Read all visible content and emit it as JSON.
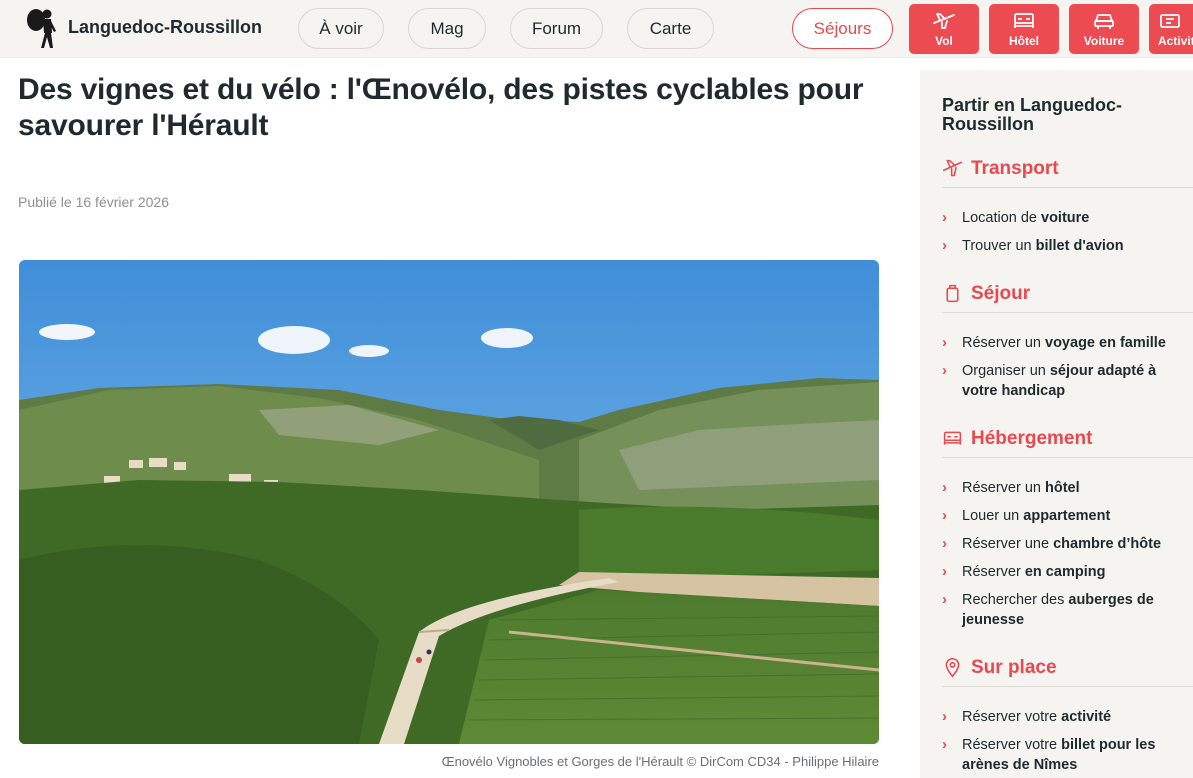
{
  "header": {
    "site_name": "Languedoc-Roussillon",
    "nav": [
      "À voir",
      "Mag",
      "Forum",
      "Carte"
    ],
    "sejours": "Séjours",
    "tiles": [
      {
        "label": "Vol",
        "icon": "plane-icon"
      },
      {
        "label": "Hôtel",
        "icon": "bed-icon"
      },
      {
        "label": "Voiture",
        "icon": "car-icon"
      },
      {
        "label": "Activit",
        "icon": "ticket-icon"
      }
    ]
  },
  "article": {
    "title": "Des vignes et du vélo : l'Œnovélo, des pistes cyclables pour savourer l'Hérault",
    "published": "Publié le 16 février 2026",
    "caption": "Œnovélo Vignobles et Gorges de l'Hérault © DirCom CD34 - Philippe Hilaire"
  },
  "sidebar": {
    "title": "Partir en Languedoc-Roussillon",
    "sections": [
      {
        "title": "Transport",
        "icon": "plane-icon",
        "links": [
          {
            "pre": "Location de ",
            "bold": "voiture",
            "post": ""
          },
          {
            "pre": "Trouver un ",
            "bold": "billet d'avion",
            "post": ""
          }
        ]
      },
      {
        "title": "Séjour",
        "icon": "suitcase-icon",
        "links": [
          {
            "pre": "Réserver un ",
            "bold": "voyage en famille",
            "post": ""
          },
          {
            "pre": "Organiser un ",
            "bold": "séjour adapté à votre handicap",
            "post": ""
          }
        ]
      },
      {
        "title": "Hébergement",
        "icon": "bed-icon",
        "links": [
          {
            "pre": "Réserver un ",
            "bold": "hôtel",
            "post": ""
          },
          {
            "pre": "Louer un ",
            "bold": "appartement",
            "post": ""
          },
          {
            "pre": "Réserver une ",
            "bold": "chambre d’hôte",
            "post": ""
          },
          {
            "pre": "Réserver ",
            "bold": "en camping",
            "post": ""
          },
          {
            "pre": "Rechercher des ",
            "bold": "auberges de jeunesse",
            "post": ""
          }
        ]
      },
      {
        "title": "Sur place",
        "icon": "map-pin-icon",
        "links": [
          {
            "pre": "Réserver votre ",
            "bold": "activité",
            "post": ""
          },
          {
            "pre": "Réserver votre ",
            "bold": "billet pour les arènes de Nîmes",
            "post": ""
          }
        ]
      }
    ]
  },
  "colors": {
    "accent": "#e8484f",
    "tile": "#ec4b52",
    "sidebar_bg": "#f6f4f1"
  }
}
